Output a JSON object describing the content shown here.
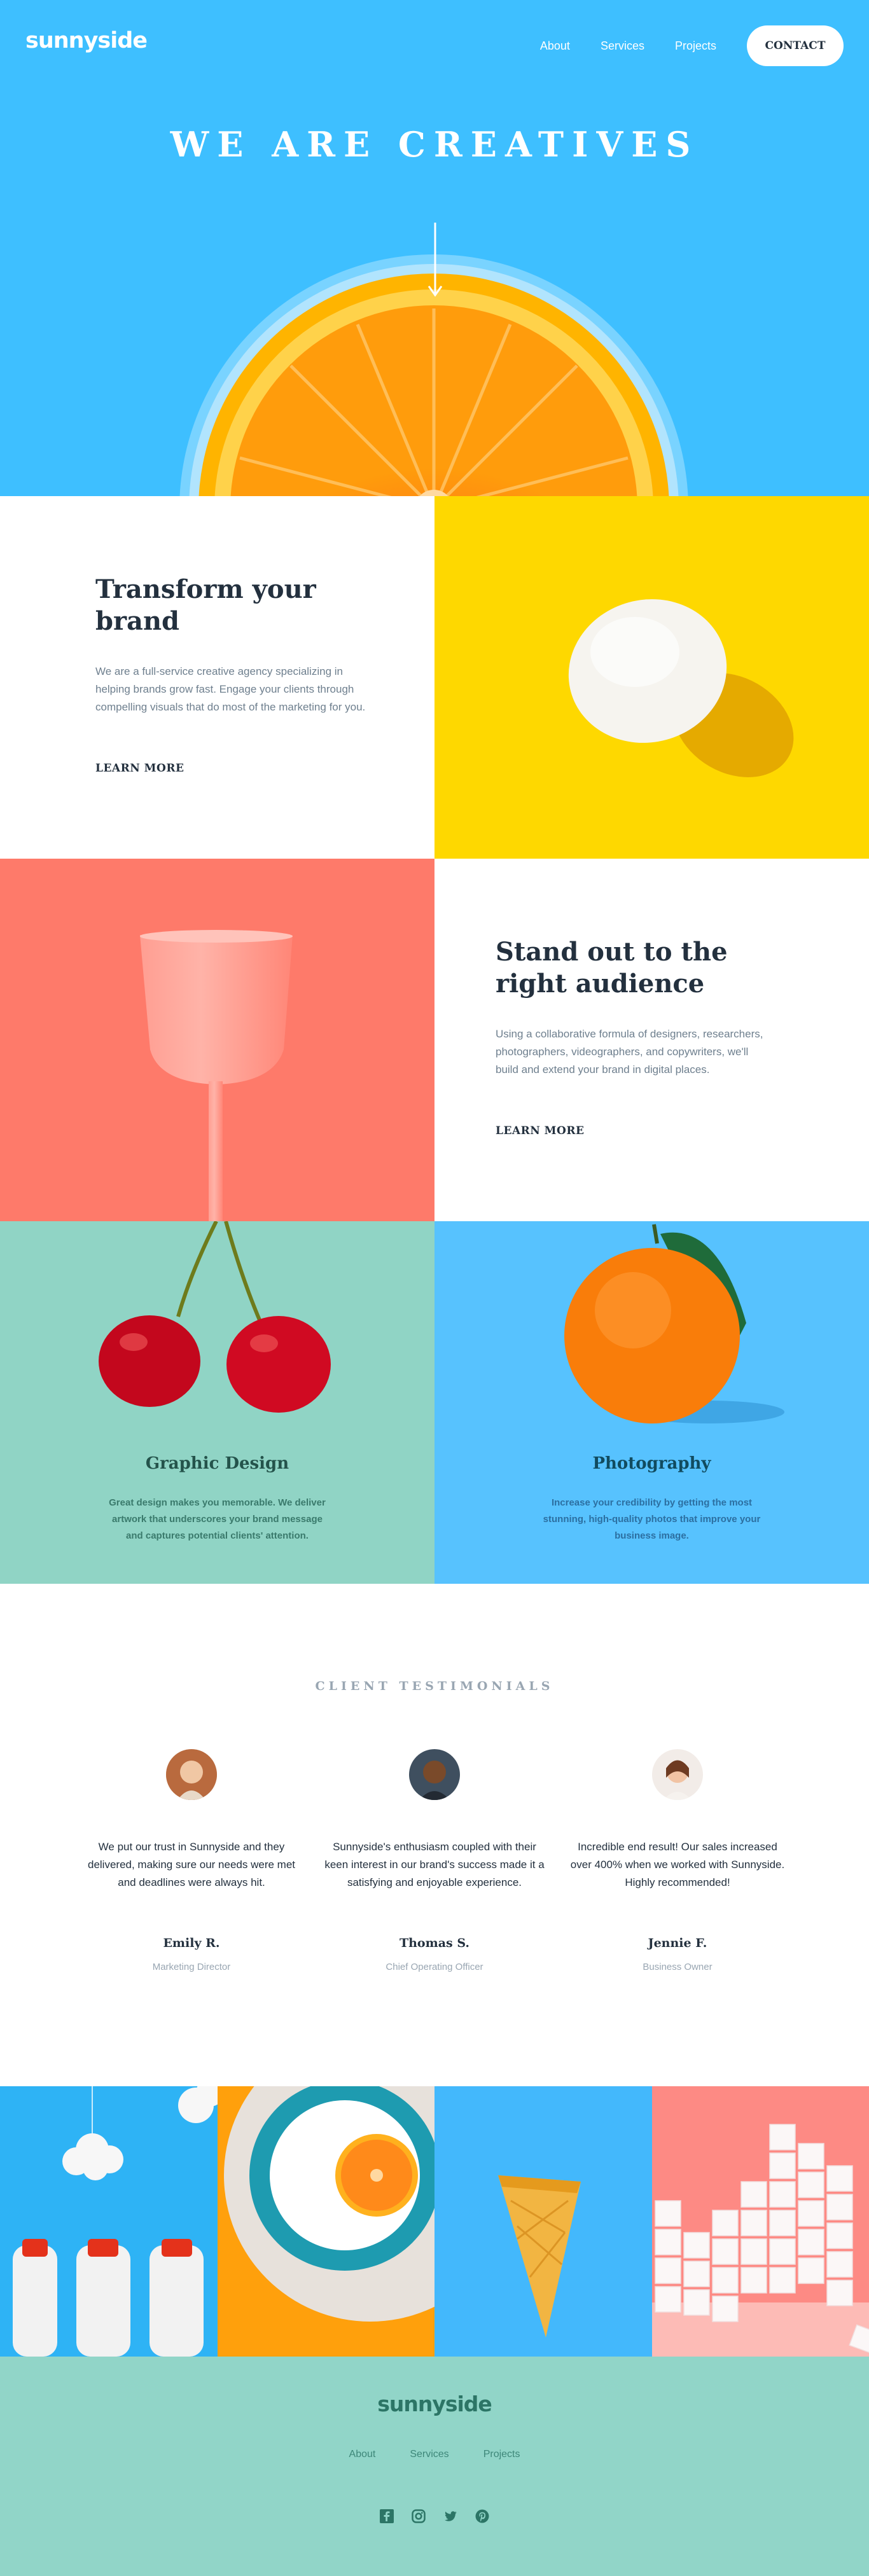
{
  "header": {
    "logo": "sunnyside",
    "nav": [
      "About",
      "Services",
      "Projects"
    ],
    "contact": "CONTACT"
  },
  "hero": {
    "title": "WE ARE CREATIVES"
  },
  "transform": {
    "title_line1": "Transform your",
    "title_line2": "brand",
    "body": "We are a full-service creative agency specializing in helping brands grow fast. Engage your clients through compelling visuals that do most of the marketing for you.",
    "cta": "LEARN MORE"
  },
  "standout": {
    "title_line1": "Stand out to the",
    "title_line2": "right audience",
    "body": "Using a collaborative formula of designers, researchers, photographers, videographers, and copywriters, we'll build and extend your brand in digital places.",
    "cta": "LEARN MORE"
  },
  "services": [
    {
      "title": "Graphic Design",
      "body": "Great design makes you memorable. We deliver artwork that underscores your brand message and captures potential clients' attention."
    },
    {
      "title": "Photography",
      "body": "Increase your credibility by getting the most stunning, high-quality photos that improve your business image."
    }
  ],
  "testimonials": {
    "heading": "CLIENT TESTIMONIALS",
    "items": [
      {
        "quote": "We put our trust in Sunnyside and they delivered, making sure our needs were met and deadlines were always hit.",
        "name": "Emily R.",
        "role": "Marketing Director"
      },
      {
        "quote": "Sunnyside's enthusiasm coupled with their keen interest in our brand's success made it a satisfying and enjoyable experience.",
        "name": "Thomas S.",
        "role": "Chief Operating Officer"
      },
      {
        "quote": "Incredible end result! Our sales increased over 400% when we worked with Sunnyside. Highly recommended!",
        "name": "Jennie F.",
        "role": "Business Owner"
      }
    ]
  },
  "footer": {
    "logo": "sunnyside",
    "nav": [
      "About",
      "Services",
      "Projects"
    ],
    "social_icons": [
      "facebook-icon",
      "instagram-icon",
      "twitter-icon",
      "pinterest-icon"
    ]
  },
  "colors": {
    "hero_blue": "#3ebfff",
    "yellow": "#fed800",
    "coral": "#fe7a6a",
    "mint": "#90d4c5",
    "dark_navy": "#23303e",
    "footer_green": "#2c7566"
  }
}
